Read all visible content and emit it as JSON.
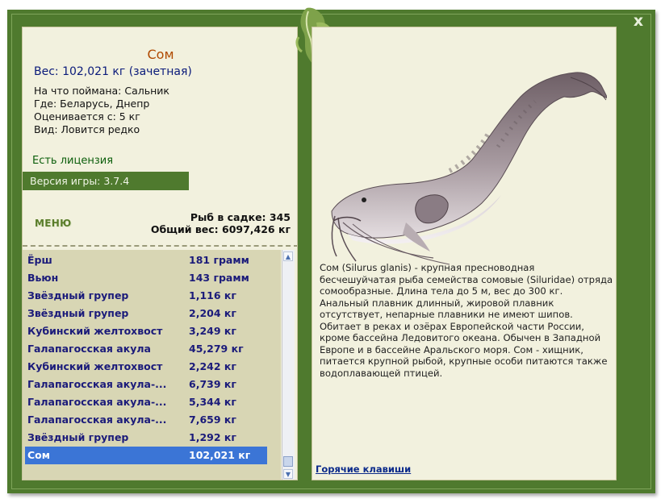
{
  "window": {
    "close_label": "x"
  },
  "fish": {
    "name": "Сом",
    "weight_line": "Вес: 102,021 кг (зачетная)",
    "caught_with": "На что поймана: Сальник",
    "location": "Где: Беларусь, Днепр",
    "valued_from": "Оценивается с:  5 кг",
    "kind": "Вид: Ловится редко",
    "description": "Сом (Silurus glanis) - крупная пресноводная бесчешуйчатая рыба семейства сомовые (Siluridae) отряда сомообразные. Длина тела до 5 м, вес до 300 кг. Анальный плавник длинный, жировой плавник отсутствует, непарные плавники не имеют шипов. Обитает в реках и озёрах Европейской части России, кроме бассейна Ледовитого океана. Обычен в Западной Европе и в бассейне Аральского моря. Сом - хищник, питается крупной рыбой, крупные особи питаются также водоплавающей птицей."
  },
  "license": "Есть лицензия",
  "version": "Версия игры: 3.7.4",
  "menu_label": "МЕНЮ",
  "stats": {
    "fish_in_cage": "Рыб в садке: 345",
    "total_weight": "Общий вес: 6097,426 кг"
  },
  "catch_list": [
    {
      "name": "Ёрш",
      "weight": "181 грамм"
    },
    {
      "name": "Вьюн",
      "weight": "143 грамм"
    },
    {
      "name": "Звёздный групер",
      "weight": "1,116 кг"
    },
    {
      "name": "Звёздный групер",
      "weight": "2,204 кг"
    },
    {
      "name": "Кубинский желтохвост",
      "weight": "3,249 кг"
    },
    {
      "name": "Галапагосская акула",
      "weight": "45,279 кг"
    },
    {
      "name": "Кубинский желтохвост",
      "weight": "2,242 кг"
    },
    {
      "name": "Галапагосская акула-...",
      "weight": "6,739 кг"
    },
    {
      "name": "Галапагосская акула-...",
      "weight": "5,344 кг"
    },
    {
      "name": "Галапагосская акула-...",
      "weight": "7,659 кг"
    },
    {
      "name": "Звёздный групер",
      "weight": "1,292 кг"
    },
    {
      "name": "Сом",
      "weight": "102,021 кг",
      "selected": true
    }
  ],
  "hotkeys_label": "Горячие клавиши",
  "colors": {
    "frame": "#4f7a2e",
    "panel": "#f2f1de",
    "list_bg": "#d8d6b4",
    "selection": "#3b75d6",
    "fish_name": "#b04a00",
    "weight_text": "#0a1a7a"
  }
}
